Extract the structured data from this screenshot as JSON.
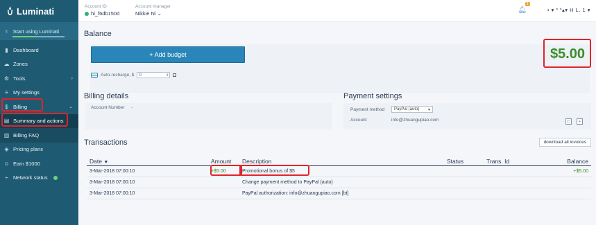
{
  "app": {
    "name": "Luminati"
  },
  "sidebar": {
    "start_label": "Start using Luminati",
    "items": [
      {
        "label": "Dashboard",
        "icon": "bar-chart-icon"
      },
      {
        "label": "Zones",
        "icon": "cloud-icon"
      },
      {
        "label": "Tools",
        "icon": "gear-icon"
      },
      {
        "label": "My settings",
        "icon": "sliders-icon"
      },
      {
        "label": "Billing",
        "icon": "dollar-icon"
      },
      {
        "label": "Summary and actions",
        "icon": "document-icon"
      },
      {
        "label": "Billing FAQ",
        "icon": "book-icon"
      },
      {
        "label": "Pricing plans",
        "icon": "tag-icon"
      },
      {
        "label": "Earn $1000",
        "icon": "people-icon"
      },
      {
        "label": "Network status",
        "icon": "signal-icon"
      }
    ]
  },
  "header": {
    "account_id_label": "Account ID",
    "account_id": "hl_f6db150d",
    "manager_label": "Account manager",
    "manager": "Nikkie Ni",
    "notification_count": "1",
    "user": "• ▾ ˟ ˟▴▾ H L. 1 ▾"
  },
  "balance": {
    "title": "Balance",
    "add_budget": "+ Add budget",
    "auto_recharge_label": "Auto-recharge, $",
    "auto_recharge_value": "0",
    "amount": "$5.00"
  },
  "billing_details": {
    "title": "Billing details",
    "account_number_label": "Account Number",
    "account_number": "-"
  },
  "payment_settings": {
    "title": "Payment settings",
    "method_label": "Payment method",
    "method_value": "PayPal (auto)",
    "account_label": "Account",
    "account_value": "info@zhuangupiao.com"
  },
  "transactions": {
    "title": "Transactions",
    "download_label": "download all invoices",
    "columns": [
      "Date",
      "Amount",
      "Description",
      "Status",
      "Trans. Id",
      "Balance"
    ],
    "rows": [
      {
        "date": "3-Mar-2018 07:00:10",
        "amount": "+$5.00",
        "description": "Promotional bonus of $5",
        "status": "",
        "trans_id": "",
        "balance": "+$5.00"
      },
      {
        "date": "3-Mar-2018 07:00:10",
        "amount": "",
        "description": "Change payment method to PayPal (auto)",
        "status": "",
        "trans_id": "",
        "balance": ""
      },
      {
        "date": "3-Mar-2018 07:00:10",
        "amount": "",
        "description": "PayPal authorization: info@zhuangupiao.com [bt]",
        "status": "",
        "trans_id": "",
        "balance": ""
      }
    ]
  },
  "colors": {
    "sidebar": "#1f5a73",
    "accent": "#2a86b8",
    "positive": "#3a8e2a",
    "highlight": "#e0242a"
  }
}
